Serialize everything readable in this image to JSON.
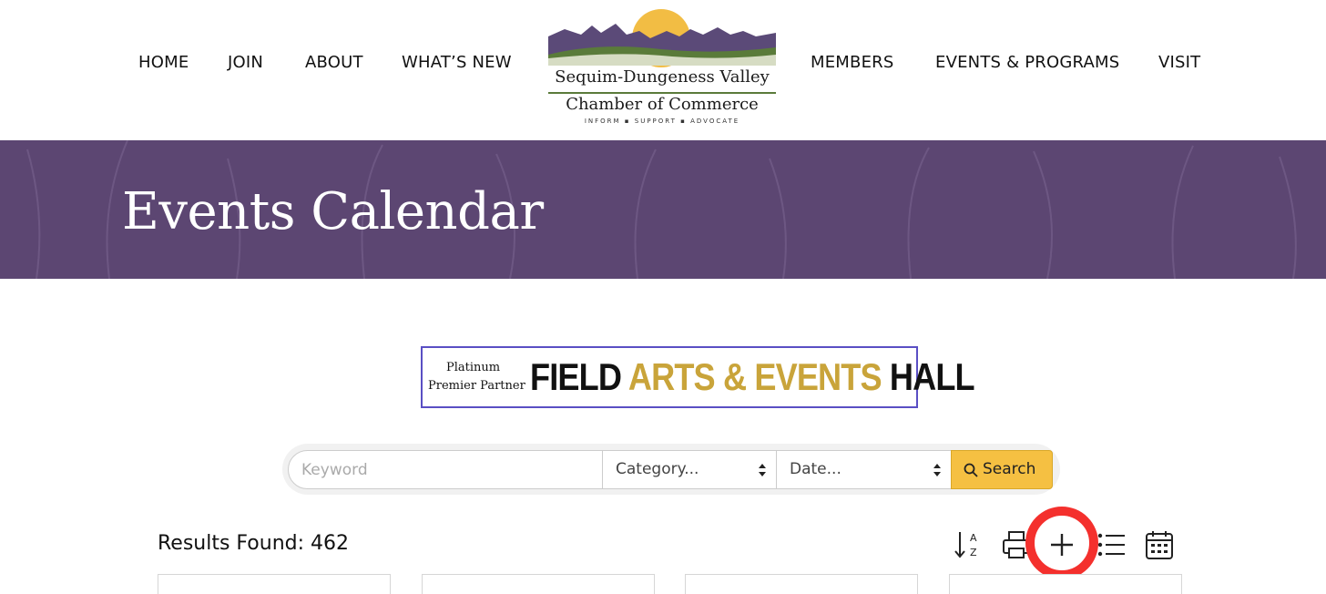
{
  "nav": {
    "left": [
      "HOME",
      "JOIN",
      "ABOUT",
      "WHAT’S NEW"
    ],
    "right": [
      "MEMBERS",
      "EVENTS & PROGRAMS",
      "VISIT"
    ]
  },
  "logo": {
    "line1": "Sequim-Dungeness Valley",
    "line2": "Chamber of Commerce",
    "tagline": "INFORM ▪ SUPPORT ▪ ADVOCATE",
    "colors": {
      "sun": "#f2bd44",
      "mountains": "#5b4a78",
      "hills": "#5a7b3a"
    }
  },
  "banner": {
    "title": "Events Calendar",
    "color": "#5c4672"
  },
  "partner_ad": {
    "line1": "Platinum",
    "line2": "Premier Partner",
    "brand_word1": "FIELD",
    "brand_word2": "ARTS & EVENTS",
    "brand_word3": "HALL",
    "colors": {
      "dark": "#111111",
      "gold": "#c9a43a",
      "border": "#5a4fc4"
    }
  },
  "search": {
    "keyword_placeholder": "Keyword",
    "category_label": "Category...",
    "date_label": "Date...",
    "button_label": "Search",
    "button_color": "#f5c042"
  },
  "results": {
    "label": "Results Found:",
    "count": "462"
  },
  "toolbar_icons": [
    "sort-az-icon",
    "print-icon",
    "add-icon",
    "list-view-icon",
    "calendar-view-icon"
  ],
  "highlight_color": "#f4302d"
}
